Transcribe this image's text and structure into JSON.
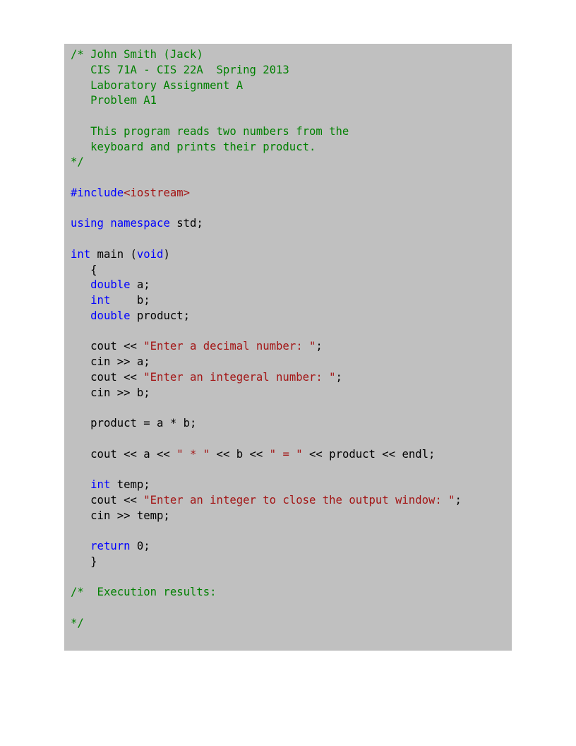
{
  "colors": {
    "background": "#c0c0c0",
    "comment": "#008000",
    "keyword": "#0000ff",
    "string": "#a31515",
    "text": "#000000"
  },
  "lines": [
    [
      {
        "t": "cm",
        "v": "/* John Smith (Jack)"
      }
    ],
    [
      {
        "t": "cm",
        "v": "   CIS 71A - CIS 22A  Spring 2013"
      }
    ],
    [
      {
        "t": "cm",
        "v": "   Laboratory Assignment A"
      }
    ],
    [
      {
        "t": "cm",
        "v": "   Problem A1"
      }
    ],
    [],
    [
      {
        "t": "cm",
        "v": "   This program reads two numbers from the"
      }
    ],
    [
      {
        "t": "cm",
        "v": "   keyboard and prints their product."
      }
    ],
    [
      {
        "t": "cm",
        "v": "*/"
      }
    ],
    [],
    [
      {
        "t": "pp",
        "v": "#include"
      },
      {
        "t": "st",
        "v": "<iostream>"
      }
    ],
    [],
    [
      {
        "t": "kw",
        "v": "using"
      },
      {
        "t": "tx",
        "v": " "
      },
      {
        "t": "kw",
        "v": "namespace"
      },
      {
        "t": "tx",
        "v": " std;"
      }
    ],
    [],
    [
      {
        "t": "kw",
        "v": "int"
      },
      {
        "t": "tx",
        "v": " main ("
      },
      {
        "t": "kw",
        "v": "void"
      },
      {
        "t": "tx",
        "v": ")"
      }
    ],
    [
      {
        "t": "tx",
        "v": "   {"
      }
    ],
    [
      {
        "t": "tx",
        "v": "   "
      },
      {
        "t": "kw",
        "v": "double"
      },
      {
        "t": "tx",
        "v": " a;"
      }
    ],
    [
      {
        "t": "tx",
        "v": "   "
      },
      {
        "t": "kw",
        "v": "int"
      },
      {
        "t": "tx",
        "v": "    b;"
      }
    ],
    [
      {
        "t": "tx",
        "v": "   "
      },
      {
        "t": "kw",
        "v": "double"
      },
      {
        "t": "tx",
        "v": " product;"
      }
    ],
    [],
    [
      {
        "t": "tx",
        "v": "   cout << "
      },
      {
        "t": "st",
        "v": "\"Enter a decimal number: \""
      },
      {
        "t": "tx",
        "v": ";"
      }
    ],
    [
      {
        "t": "tx",
        "v": "   cin >> a;"
      }
    ],
    [
      {
        "t": "tx",
        "v": "   cout << "
      },
      {
        "t": "st",
        "v": "\"Enter an integeral number: \""
      },
      {
        "t": "tx",
        "v": ";"
      }
    ],
    [
      {
        "t": "tx",
        "v": "   cin >> b;"
      }
    ],
    [],
    [
      {
        "t": "tx",
        "v": "   product = a * b;"
      }
    ],
    [],
    [
      {
        "t": "tx",
        "v": "   cout << a << "
      },
      {
        "t": "st",
        "v": "\" * \""
      },
      {
        "t": "tx",
        "v": " << b << "
      },
      {
        "t": "st",
        "v": "\" = \""
      },
      {
        "t": "tx",
        "v": " << product << endl;"
      }
    ],
    [],
    [
      {
        "t": "tx",
        "v": "   "
      },
      {
        "t": "kw",
        "v": "int"
      },
      {
        "t": "tx",
        "v": " temp;"
      }
    ],
    [
      {
        "t": "tx",
        "v": "   cout << "
      },
      {
        "t": "st",
        "v": "\"Enter an integer to close the output window: \""
      },
      {
        "t": "tx",
        "v": ";"
      }
    ],
    [
      {
        "t": "tx",
        "v": "   cin >> temp;"
      }
    ],
    [],
    [
      {
        "t": "tx",
        "v": "   "
      },
      {
        "t": "kw",
        "v": "return"
      },
      {
        "t": "tx",
        "v": " 0;"
      }
    ],
    [
      {
        "t": "tx",
        "v": "   }"
      }
    ],
    [],
    [
      {
        "t": "cm",
        "v": "/*  Execution results:"
      }
    ],
    [],
    [
      {
        "t": "cm",
        "v": "*/"
      }
    ]
  ]
}
